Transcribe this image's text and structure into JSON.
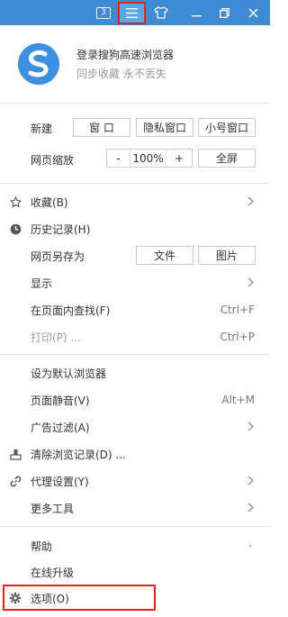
{
  "titlebar": {
    "tab_count": "3",
    "icons": [
      "tab-counter-icon",
      "menu-icon",
      "skin-icon",
      "minimize-icon",
      "restore-icon",
      "close-icon"
    ]
  },
  "login": {
    "title": "登录搜狗高速浏览器",
    "subtitle": "同步收藏 永不丢失"
  },
  "new_row": {
    "label": "新建",
    "window": "窗 口",
    "private_window": "隐私窗口",
    "small_window": "小号窗口"
  },
  "zoom_row": {
    "label": "网页缩放",
    "minus": "-",
    "value": "100%",
    "plus": "+",
    "fullscreen": "全屏"
  },
  "menu": {
    "favorites": "收藏(B)",
    "history": "历史记录(H)",
    "save_as": "网页另存为",
    "save_file": "文件",
    "save_image": "图片",
    "display": "显示",
    "find": "在页面内查找(F)",
    "find_shortcut": "Ctrl+F",
    "print": "打印(P) ...",
    "print_shortcut": "Ctrl+P",
    "set_default": "设为默认浏览器",
    "mute": "页面静音(V)",
    "mute_shortcut": "Alt+M",
    "ad_filter": "广告过滤(A)",
    "clear_data": "清除浏览记录(D) ...",
    "proxy": "代理设置(Y)",
    "more_tools": "更多工具",
    "help": "帮助",
    "upgrade": "在线升级",
    "options": "选项(O)"
  },
  "colors": {
    "titlebar": "#3f8ad2",
    "highlight_border": "#e0261c",
    "logo": "#3d8fe0"
  }
}
